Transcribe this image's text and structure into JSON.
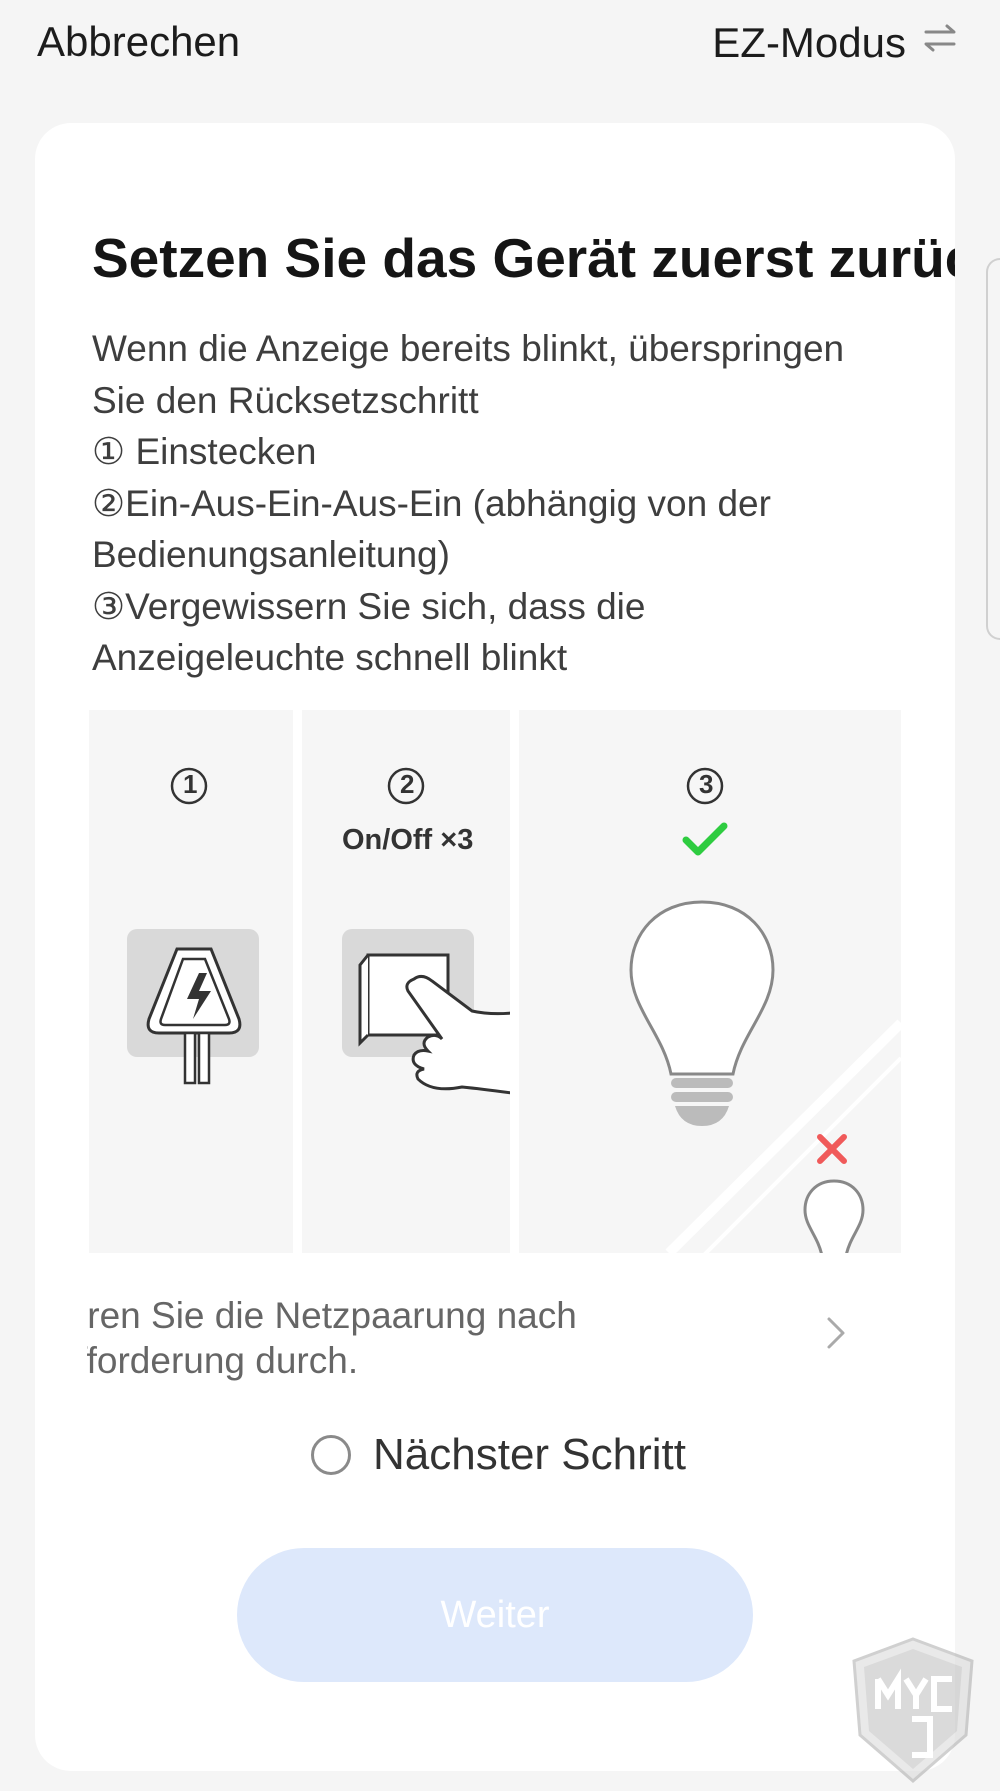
{
  "header": {
    "cancel_label": "Abbrechen",
    "mode_label": "EZ-Modus",
    "mode_icon": "swap-arrows-icon"
  },
  "card": {
    "title": "Setzen Sie das Gerät zuerst zurück",
    "description_lines": [
      "Wenn die Anzeige bereits blinkt, überspringen",
      "Sie den Rücksetzschritt",
      "① Einstecken",
      "②Ein-Aus-Ein-Aus-Ein (abhängig von der",
      "Bedienungsanleitung)",
      "③Vergewissern Sie sich, dass die",
      "Anzeigeleuchte schnell blinkt"
    ],
    "illustration": {
      "steps": [
        "①",
        "②",
        "③"
      ],
      "onoff_label": "On/Off ×3"
    },
    "pairing_lines": [
      "ıren Sie die Netzpaarung nach",
      "fforderung durch."
    ],
    "next_step_label": "Nächster Schritt",
    "continue_label": "Weiter"
  },
  "colors": {
    "background": "#f5f5f5",
    "card": "#ffffff",
    "button_disabled": "#dde8fb",
    "check_green": "#2ecc40",
    "cross_red": "#f05a5a"
  }
}
